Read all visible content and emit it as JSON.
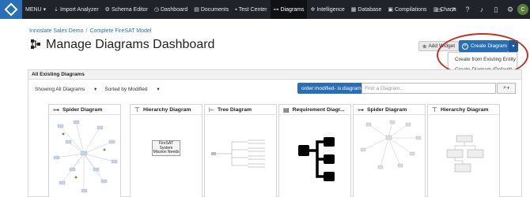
{
  "nav": {
    "menu_label": "MENU",
    "items": [
      {
        "label": "Import Analyzer",
        "icon": "import-icon"
      },
      {
        "label": "Schema Editor",
        "icon": "schema-icon"
      },
      {
        "label": "Dashboard",
        "icon": "dashboard-icon"
      },
      {
        "label": "Documents",
        "icon": "documents-icon"
      },
      {
        "label": "Test Center",
        "icon": "test-icon"
      },
      {
        "label": "Diagrams",
        "icon": "diagram-icon",
        "active": true
      },
      {
        "label": "Intelligence",
        "icon": "intelligence-icon"
      },
      {
        "label": "Database",
        "icon": "database-icon"
      },
      {
        "label": "Compilations",
        "icon": "compilations-icon"
      },
      {
        "label": "Charts",
        "icon": "charts-icon"
      }
    ],
    "avatar_initial": "C"
  },
  "breadcrumb": {
    "project": "Innoslate Sales Demo",
    "model": "Complete FireSAT Model"
  },
  "page": {
    "title": "Manage Diagrams Dashboard"
  },
  "actions": {
    "add_widget": "Add Widget",
    "create_diagram": "Create Diagram",
    "dropdown": [
      "Create from Existing Entity",
      "Create Diagram (Default)"
    ]
  },
  "panel": {
    "title": "All Existing Diagrams",
    "filter_showing": "Showing All Diagrams",
    "filter_sort": "Sorted by Modified",
    "query_tag": "order:modified- is:diagram",
    "search_placeholder": "Find a Diagram..."
  },
  "cards": [
    {
      "title": "Spider Diagram"
    },
    {
      "title": "Hierarchy Diagram",
      "thumb_text": "FireSAT System Mission Needs"
    },
    {
      "title": "Tree Diagram"
    },
    {
      "title": "Requirement Diagr..."
    },
    {
      "title": "Spider Diagram"
    },
    {
      "title": "Hierarchy Diagram"
    }
  ],
  "colors": {
    "nav_bg": "#20242a",
    "accent": "#2a6fb5",
    "highlight": "#b8342c"
  }
}
